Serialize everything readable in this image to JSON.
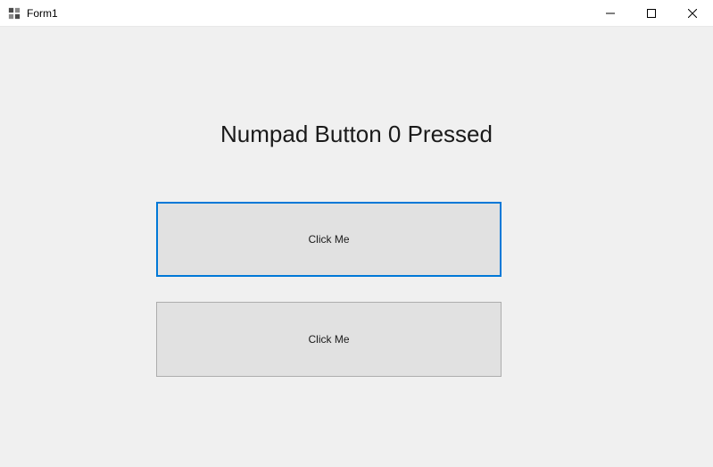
{
  "window": {
    "title": "Form1"
  },
  "content": {
    "message": "Numpad Button 0 Pressed",
    "button1_label": "Click Me",
    "button2_label": "Click Me"
  }
}
